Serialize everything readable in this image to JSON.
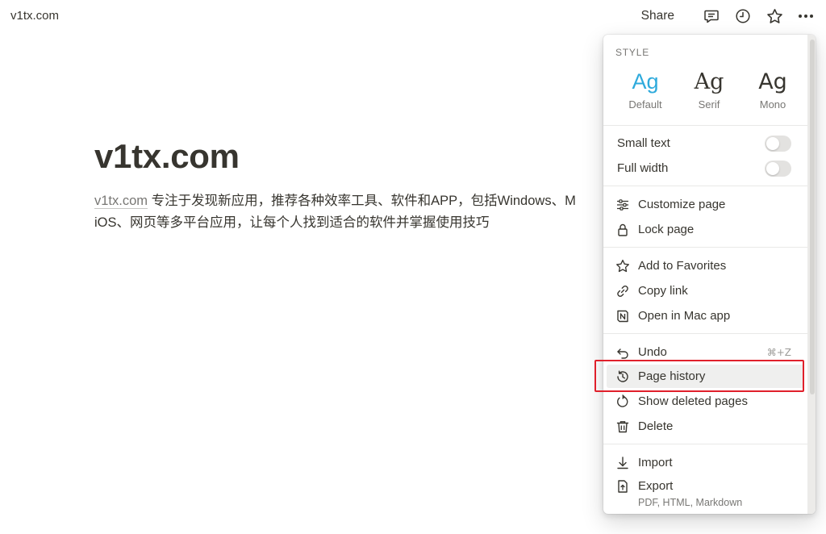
{
  "topbar": {
    "breadcrumb": "v1tx.com",
    "share_label": "Share",
    "icons": [
      "comment-icon",
      "history-clock-icon",
      "star-icon",
      "more-dots-icon"
    ]
  },
  "page": {
    "title": "v1tx.com",
    "link_text": "v1tx.com",
    "description_rest": " 专注于发现新应用，推荐各种效率工具、软件和APP，包括Windows、M",
    "description_line2": "iOS、网页等多平台应用，让每个人找到适合的软件并掌握使用技巧"
  },
  "menu": {
    "style_label": "STYLE",
    "fonts": [
      {
        "sample": "Ag",
        "name": "Default",
        "selected": true
      },
      {
        "sample": "Ag",
        "name": "Serif",
        "selected": false
      },
      {
        "sample": "Ag",
        "name": "Mono",
        "selected": false
      }
    ],
    "toggles": [
      {
        "label": "Small text",
        "on": false
      },
      {
        "label": "Full width",
        "on": false
      }
    ],
    "items": {
      "customize": "Customize page",
      "lock": "Lock page",
      "favorites": "Add to Favorites",
      "copy_link": "Copy link",
      "open_mac": "Open in Mac app",
      "undo": "Undo",
      "undo_shortcut": "⌘+Z",
      "history": "Page history",
      "show_deleted": "Show deleted pages",
      "delete": "Delete",
      "import": "Import",
      "export": "Export",
      "export_sub": "PDF, HTML, Markdown"
    }
  },
  "colors": {
    "accent": "#2eaadc",
    "text": "#37352f",
    "muted": "#787774",
    "highlight_border": "#e0202b",
    "hover_bg": "#efefee"
  }
}
